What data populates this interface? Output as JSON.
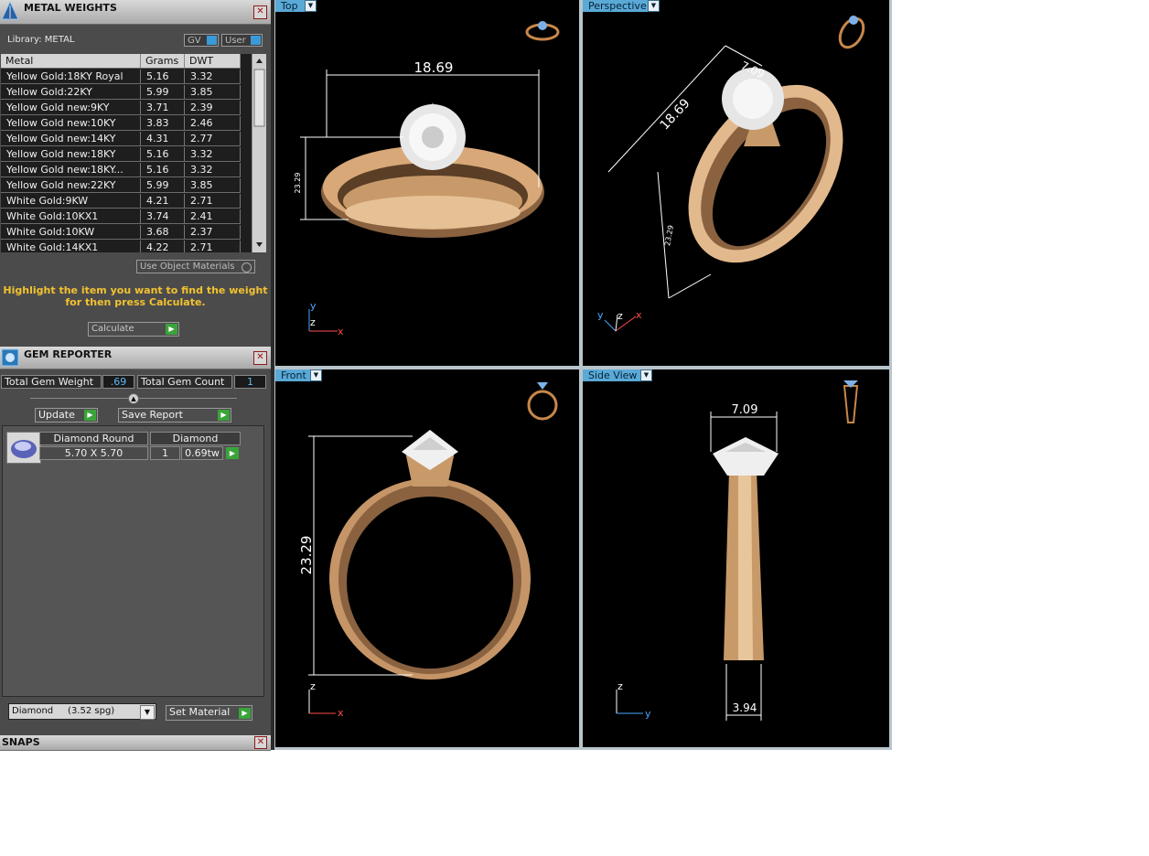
{
  "metal_weights": {
    "title": "METAL WEIGHTS",
    "library_label": "Library: METAL",
    "gv_label": "GV",
    "user_label": "User",
    "columns": [
      "Metal",
      "Grams",
      "DWT"
    ],
    "rows": [
      {
        "metal": "Yellow Gold:18KY Royal",
        "grams": "5.16",
        "dwt": "3.32"
      },
      {
        "metal": "Yellow Gold:22KY",
        "grams": "5.99",
        "dwt": "3.85"
      },
      {
        "metal": "Yellow Gold new:9KY",
        "grams": "3.71",
        "dwt": "2.39"
      },
      {
        "metal": "Yellow Gold new:10KY",
        "grams": "3.83",
        "dwt": "2.46"
      },
      {
        "metal": "Yellow Gold new:14KY",
        "grams": "4.31",
        "dwt": "2.77"
      },
      {
        "metal": "Yellow Gold new:18KY",
        "grams": "5.16",
        "dwt": "3.32"
      },
      {
        "metal": "Yellow Gold new:18KY...",
        "grams": "5.16",
        "dwt": "3.32"
      },
      {
        "metal": "Yellow Gold new:22KY",
        "grams": "5.99",
        "dwt": "3.85"
      },
      {
        "metal": "White Gold:9KW",
        "grams": "4.21",
        "dwt": "2.71"
      },
      {
        "metal": "White Gold:10KX1",
        "grams": "3.74",
        "dwt": "2.41"
      },
      {
        "metal": "White Gold:10KW",
        "grams": "3.68",
        "dwt": "2.37"
      },
      {
        "metal": "White Gold:14KX1",
        "grams": "4.22",
        "dwt": "2.71"
      }
    ],
    "use_object_materials": "Use Object Materials",
    "hint_line1": "Highlight the item you want to find the weight",
    "hint_line2": "for then press Calculate.",
    "calculate_label": "Calculate",
    "hint_color": "#f2c230"
  },
  "gem_reporter": {
    "title": "GEM REPORTER",
    "total_weight_label": "Total Gem Weight",
    "total_weight_value": ".69",
    "total_count_label": "Total Gem Count",
    "total_count_value": "1",
    "update_label": "Update",
    "save_report_label": "Save Report",
    "gem": {
      "shape": "Diamond Round",
      "type": "Diamond",
      "size": "5.70 X 5.70",
      "count": "1",
      "weight": "0.69tw"
    },
    "material_select": "Diamond     (3.52 spg)",
    "set_material_label": "Set Material"
  },
  "snaps": {
    "title": "SNAPS"
  },
  "viewports": {
    "top": {
      "label": "Top",
      "dim_width": "18.69",
      "dim_height": "23.29"
    },
    "perspective": {
      "label": "Perspective",
      "dim_diag": "18.69",
      "dim_top": "7.09",
      "dim_side": "23.29"
    },
    "front": {
      "label": "Front",
      "dim_height": "23.29"
    },
    "side": {
      "label": "Side View",
      "dim_top": "7.09",
      "dim_bottom": "3.94"
    }
  },
  "axes": {
    "x": "x",
    "y": "y",
    "z": "z"
  },
  "colors": {
    "gold": "#c89a6a",
    "viewport_bar": "#5aa9d6",
    "panel": "#4b4b4b",
    "accent_green": "#3aa43a"
  }
}
